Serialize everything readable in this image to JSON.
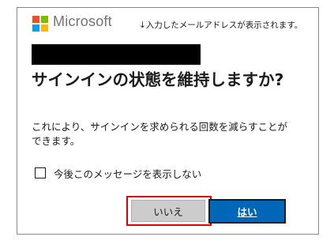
{
  "brand": {
    "name": "Microsoft",
    "logo_colors": [
      "#f25022",
      "#7fba00",
      "#00a4ef",
      "#ffb900"
    ]
  },
  "annotation": "↓入力したメールアドレスが表示されます。",
  "dialog": {
    "title": "サインインの状態を維持しますか?",
    "description": "これにより、サインインを求められる回数を減らすことができます。",
    "checkbox_label": "今後このメッセージを表示しない",
    "checkbox_checked": false,
    "no_button": "いいえ",
    "yes_button": "はい",
    "accent_color": "#0067b8",
    "highlight_color": "#e00000"
  }
}
